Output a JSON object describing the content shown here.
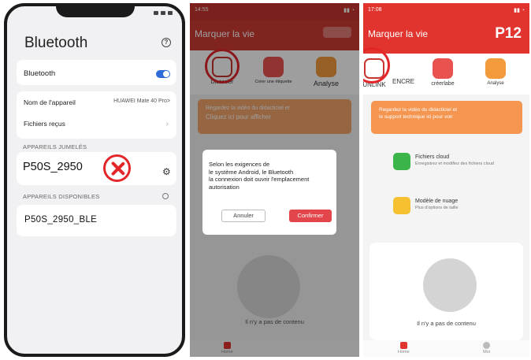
{
  "panel1": {
    "title": "Bluetooth",
    "help_icon": "?",
    "bluetooth_label": "Bluetooth",
    "bluetooth_on": true,
    "device_name_label": "Nom de l'appareil",
    "device_name_value": "HUAWEI Mate 40 Pro>",
    "received_files_label": "Fichiers reçus",
    "paired_section": "APPAREILS JUMELÉS",
    "paired_device": "P50S_2950",
    "available_section": "APPAREILS DISPONIBLES",
    "available_device": "P50S_2950_BLE",
    "accent": "#2f6bd8",
    "error_color": "#e2262a"
  },
  "panel2": {
    "status_time": "14:55",
    "title": "Marquer la vie",
    "tools": [
      "Dissocier",
      "Créer une étiquette",
      "Analyse"
    ],
    "banner_line1": "Regardez la vidéo du didacticiel et",
    "banner_line2": "Cliquez ici pour afficher",
    "empty_text": "Il n'y a pas de contenu",
    "nav_home": "Home",
    "dialog": {
      "lines": [
        "Selon les exigences de",
        "le système Android, le Bluetooth",
        " la connexion doit ouvrir l'emplacement",
        "autorisation"
      ],
      "cancel": "Annuler",
      "confirm": "Confirmer"
    }
  },
  "panel3": {
    "status_time": "17:08",
    "title": "Marquer la vie",
    "model": "P12",
    "tools": [
      "UNLINK",
      "ENCRE",
      "créerlabe",
      "Analyse"
    ],
    "banner_line1": "Regardez la vidéo du didacticiel et",
    "banner_line2": "le support technique ici pour voir",
    "feature1_title": "Fichiers cloud",
    "feature1_sub": "Enregistrez et modifiez des fichiers cloud",
    "feature2_title": "Modèle de nuage",
    "feature2_sub": "Plus d'options de taille",
    "empty_text": "Il n'y a pas de contenu",
    "nav_home": "Home",
    "nav_me": "Moi",
    "brand_color": "#e2342e"
  }
}
